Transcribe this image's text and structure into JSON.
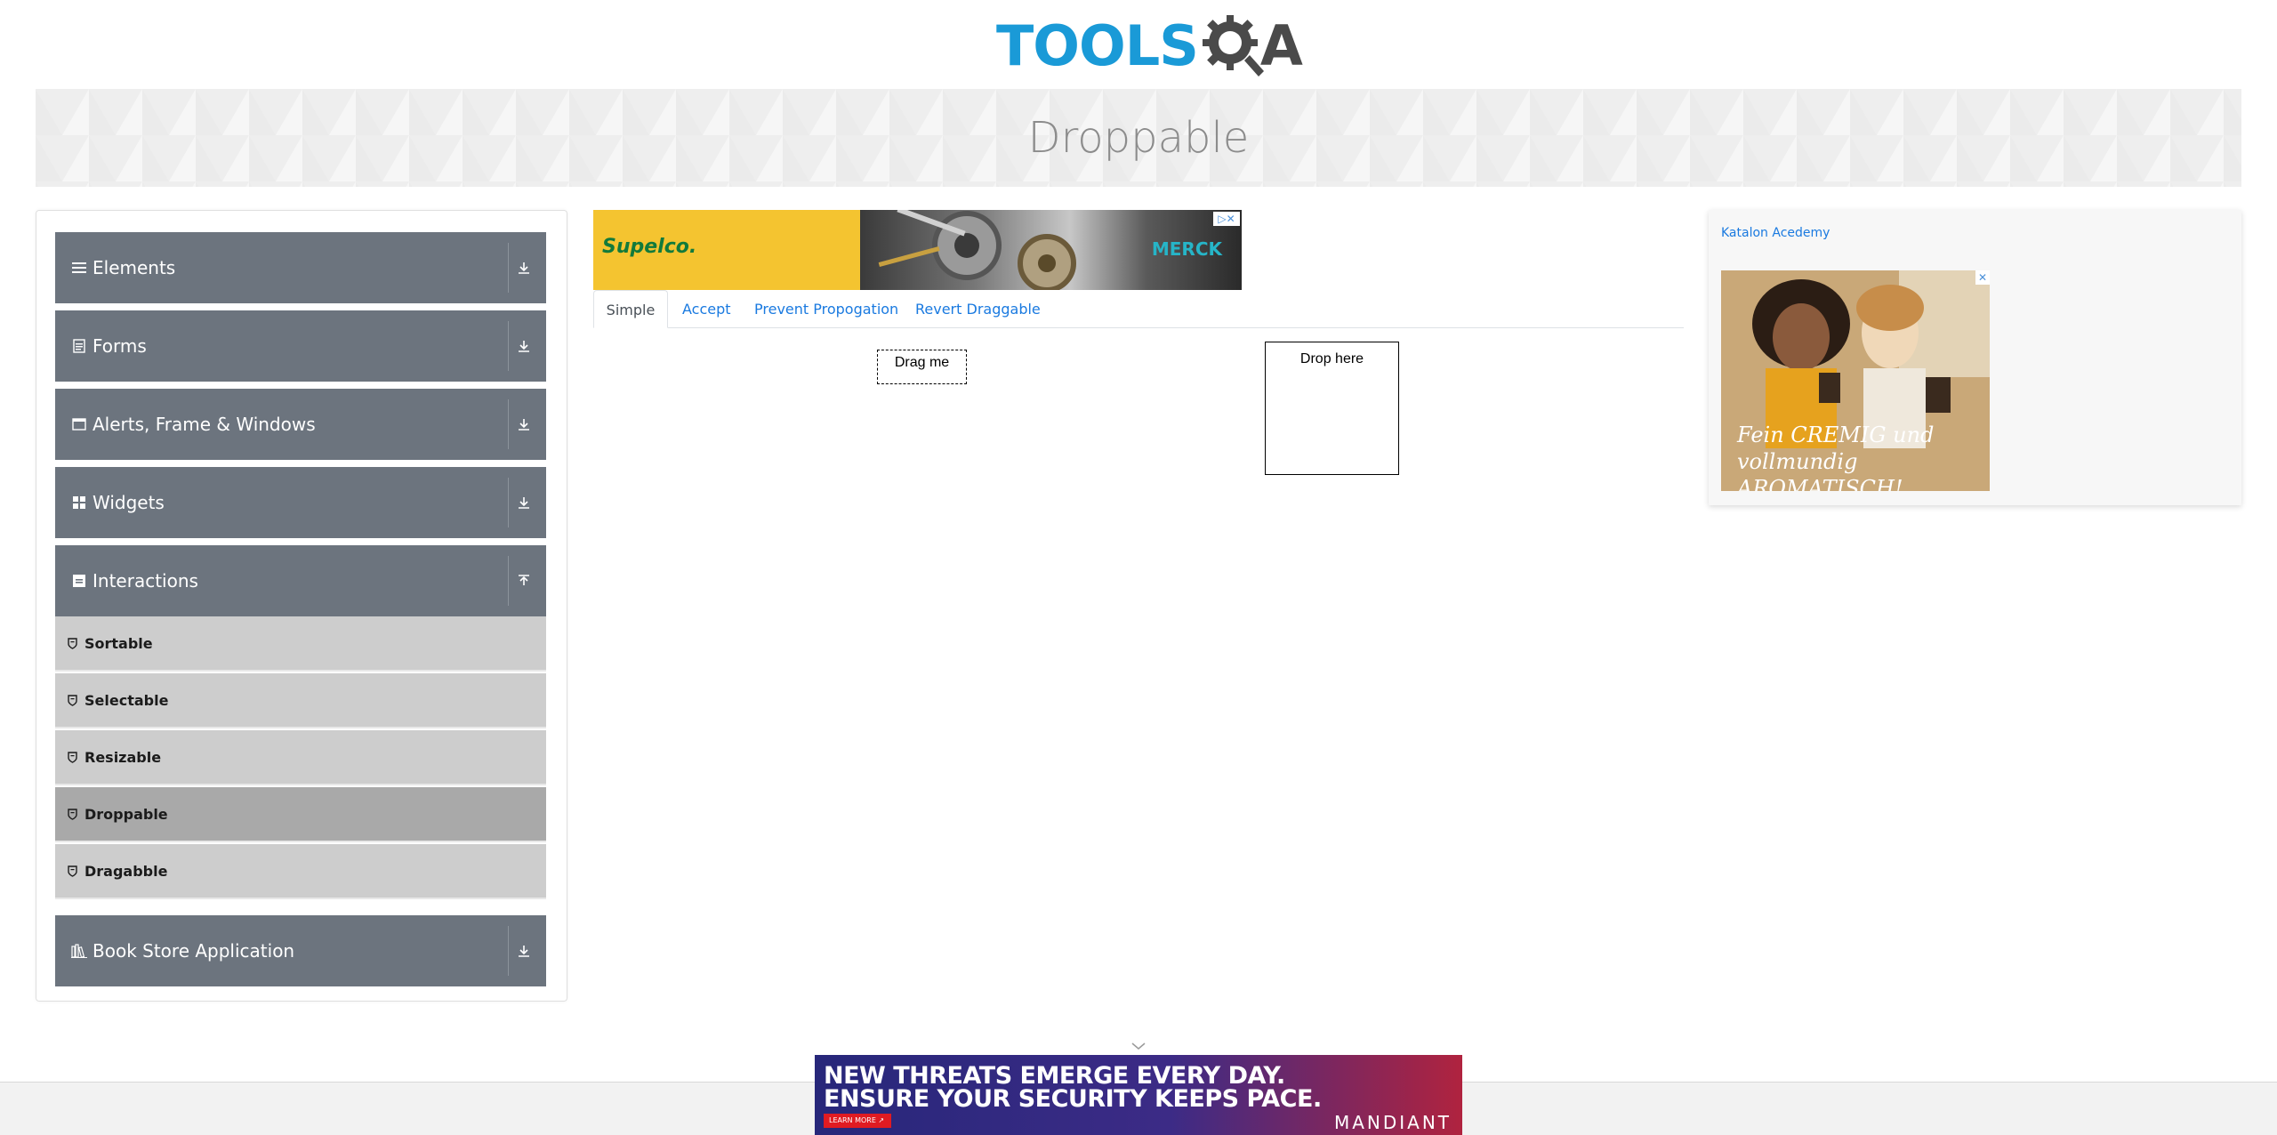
{
  "header": {
    "logo_text": "TOOLS",
    "logo_q": "Q",
    "logo_a": "A",
    "page_title": "Droppable"
  },
  "sidebar": {
    "groups": [
      {
        "label": "Elements",
        "icon": "hamburger-icon",
        "expanded": false
      },
      {
        "label": "Forms",
        "icon": "form-icon",
        "expanded": false
      },
      {
        "label": "Alerts, Frame & Windows",
        "icon": "window-icon",
        "expanded": false
      },
      {
        "label": "Widgets",
        "icon": "widgets-grid-icon",
        "expanded": false
      },
      {
        "label": "Interactions",
        "icon": "interactions-icon",
        "expanded": true
      },
      {
        "label": "Book Store Application",
        "icon": "book-store-icon",
        "expanded": false
      }
    ],
    "interactions_items": [
      {
        "label": "Sortable",
        "active": false
      },
      {
        "label": "Selectable",
        "active": false
      },
      {
        "label": "Resizable",
        "active": false
      },
      {
        "label": "Droppable",
        "active": true
      },
      {
        "label": "Dragabble",
        "active": false
      }
    ]
  },
  "top_ad": {
    "brand": "Supelco.",
    "partner": "MERCK",
    "close_label": "▷✕"
  },
  "tabs": [
    {
      "label": "Simple",
      "active": true
    },
    {
      "label": "Accept",
      "active": false
    },
    {
      "label": "Prevent Propogation",
      "active": false
    },
    {
      "label": "Revert Draggable",
      "active": false
    }
  ],
  "draggable": {
    "label": "Drag me"
  },
  "droppable": {
    "label": "Drop here"
  },
  "right_ad": {
    "alt_text": "Katalon Acedemy",
    "tagline": "Fein CREMIG und vollmundig AROMATISCH!",
    "close_label": "✕"
  },
  "bottom_ad": {
    "line1": "NEW THREATS EMERGE EVERY DAY.",
    "line2": "ENSURE YOUR SECURITY KEEPS PACE.",
    "button": "LEARN MORE ↗",
    "brand": "MANDIANT"
  },
  "colors": {
    "accent_blue": "#1a9ad7",
    "sidebar_header": "#6c747e",
    "sidebar_item": "#cdcdcd",
    "sidebar_item_active": "#a9a9a9"
  }
}
